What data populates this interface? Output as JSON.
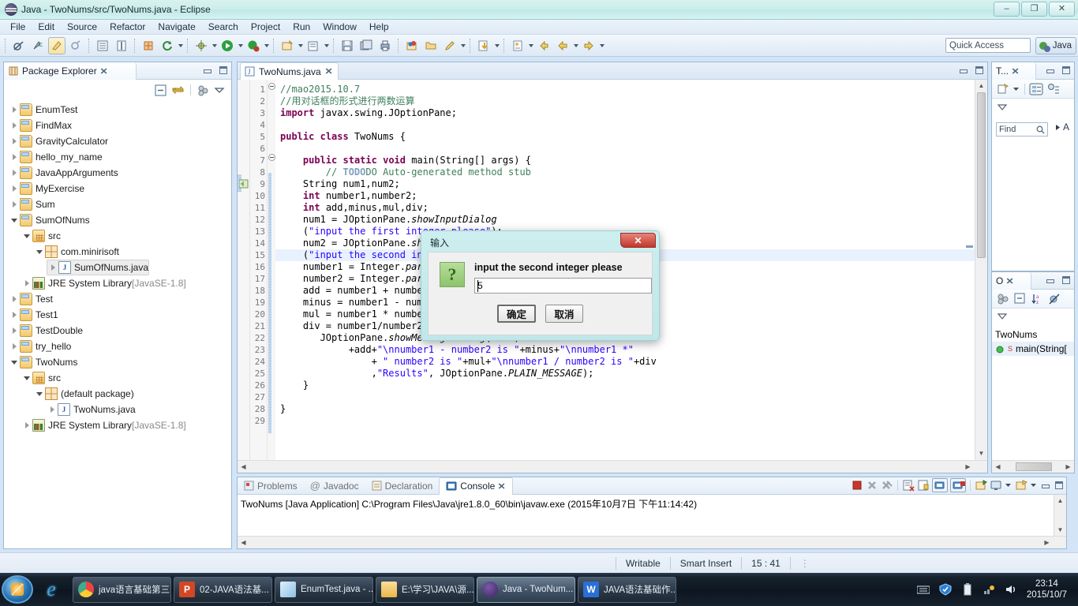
{
  "window": {
    "title": "Java - TwoNums/src/TwoNums.java - Eclipse",
    "minimize": "–",
    "restore": "❐",
    "close": "✕"
  },
  "menubar": {
    "items": [
      "File",
      "Edit",
      "Source",
      "Refactor",
      "Navigate",
      "Search",
      "Project",
      "Run",
      "Window",
      "Help"
    ]
  },
  "toolbar": {
    "quick_access_placeholder": "Quick Access",
    "perspective": "Java"
  },
  "package_explorer": {
    "tab_label": "Package Explorer",
    "close_glyph": "✕",
    "tree": [
      {
        "label": "EnumTest",
        "indent": 0,
        "arrow": "collapsed",
        "icon": "project-folder-icon",
        "selected": false
      },
      {
        "label": "FindMax",
        "indent": 0,
        "arrow": "collapsed",
        "icon": "project-folder-icon",
        "selected": false
      },
      {
        "label": "GravityCalculator",
        "indent": 0,
        "arrow": "collapsed",
        "icon": "project-folder-icon",
        "selected": false
      },
      {
        "label": "hello_my_name",
        "indent": 0,
        "arrow": "collapsed",
        "icon": "project-folder-icon",
        "selected": false
      },
      {
        "label": "JavaAppArguments",
        "indent": 0,
        "arrow": "collapsed",
        "icon": "project-folder-icon",
        "selected": false
      },
      {
        "label": "MyExercise",
        "indent": 0,
        "arrow": "collapsed",
        "icon": "project-folder-icon",
        "selected": false
      },
      {
        "label": "Sum",
        "indent": 0,
        "arrow": "collapsed",
        "icon": "project-folder-icon",
        "selected": false
      },
      {
        "label": "SumOfNums",
        "indent": 0,
        "arrow": "expanded",
        "icon": "project-folder-icon",
        "selected": false
      },
      {
        "label": "src",
        "indent": 1,
        "arrow": "expanded",
        "icon": "source-folder-icon",
        "selected": false
      },
      {
        "label": "com.minirisoft",
        "indent": 2,
        "arrow": "expanded",
        "icon": "package-icon",
        "selected": false
      },
      {
        "label": "SumOfNums.java",
        "indent": 3,
        "arrow": "collapsed",
        "icon": "java-file-icon",
        "selected": true
      },
      {
        "label": "JRE System Library",
        "suffix": "[JavaSE-1.8]",
        "indent": 1,
        "arrow": "collapsed",
        "icon": "library-icon",
        "selected": false
      },
      {
        "label": "Test",
        "indent": 0,
        "arrow": "collapsed",
        "icon": "project-folder-icon",
        "selected": false
      },
      {
        "label": "Test1",
        "indent": 0,
        "arrow": "collapsed",
        "icon": "project-folder-icon",
        "selected": false
      },
      {
        "label": "TestDouble",
        "indent": 0,
        "arrow": "collapsed",
        "icon": "project-folder-icon",
        "selected": false
      },
      {
        "label": "try_hello",
        "indent": 0,
        "arrow": "collapsed",
        "icon": "project-folder-icon",
        "selected": false
      },
      {
        "label": "TwoNums",
        "indent": 0,
        "arrow": "expanded",
        "icon": "project-folder-icon",
        "selected": false
      },
      {
        "label": "src",
        "indent": 1,
        "arrow": "expanded",
        "icon": "source-folder-icon",
        "selected": false
      },
      {
        "label": "(default package)",
        "indent": 2,
        "arrow": "expanded",
        "icon": "package-icon",
        "selected": false
      },
      {
        "label": "TwoNums.java",
        "indent": 3,
        "arrow": "collapsed",
        "icon": "java-file-icon",
        "selected": false
      },
      {
        "label": "JRE System Library",
        "suffix": "[JavaSE-1.8]",
        "indent": 1,
        "arrow": "collapsed",
        "icon": "library-icon",
        "selected": false
      }
    ]
  },
  "editor": {
    "tab_label": "TwoNums.java",
    "close_glyph": "✕",
    "first_line": 1,
    "last_line": 29,
    "highlighted_line": 15,
    "lines": [
      {
        "n": 1,
        "text": "//mao2015.10.7"
      },
      {
        "n": 2,
        "text": "//用对话框的形式进行两数运算"
      },
      {
        "n": 3,
        "text": "import javax.swing.JOptionPane;"
      },
      {
        "n": 4,
        "text": ""
      },
      {
        "n": 5,
        "text": "public class TwoNums {"
      },
      {
        "n": 6,
        "text": ""
      },
      {
        "n": 7,
        "text": "    public static void main(String[] args) {"
      },
      {
        "n": 8,
        "text": "        // TODO Auto-generated method stub"
      },
      {
        "n": 9,
        "text": "    String num1,num2;"
      },
      {
        "n": 10,
        "text": "    int number1,number2;"
      },
      {
        "n": 11,
        "text": "    int add,minus,mul,div;"
      },
      {
        "n": 12,
        "text": "    num1 = JOptionPane.showInputDialog"
      },
      {
        "n": 13,
        "text": "    (\"input the first integer please\");"
      },
      {
        "n": 14,
        "text": "    num2 = JOptionPane.showInputDialog"
      },
      {
        "n": 15,
        "text": "    (\"input the second integer please\");"
      },
      {
        "n": 16,
        "text": "    number1 = Integer.parseInt(num1);"
      },
      {
        "n": 17,
        "text": "    number2 = Integer.parseInt(num2);"
      },
      {
        "n": 18,
        "text": "    add = number1 + number2;"
      },
      {
        "n": 19,
        "text": "    minus = number1 - number2;"
      },
      {
        "n": 20,
        "text": "    mul = number1 * number2;"
      },
      {
        "n": 21,
        "text": "    div = number1/number2;"
      },
      {
        "n": 22,
        "text": "       JOptionPane.showMessageDialog(null,"
      },
      {
        "n": 23,
        "text": "            +add+\"\\nnumber1 - number2 is \"+minus+\"\\nnumber1 *\""
      },
      {
        "n": 24,
        "text": "                + \" number2 is \"+mul+\"\\nnumber1 / number2 is \"+div"
      },
      {
        "n": 25,
        "text": "                ,\"Results\", JOptionPane.PLAIN_MESSAGE);"
      },
      {
        "n": 26,
        "text": "    }"
      },
      {
        "n": 27,
        "text": ""
      },
      {
        "n": 28,
        "text": "}"
      },
      {
        "n": 29,
        "text": ""
      }
    ]
  },
  "outline_top": {
    "tab_label": "T...",
    "close_glyph": "✕",
    "find_label": "Find"
  },
  "outline_bottom": {
    "tab_label": "O",
    "close_glyph": "✕",
    "items": [
      {
        "label": "TwoNums",
        "kind": "class"
      },
      {
        "label": "main(String[",
        "kind": "method",
        "badge": "S"
      }
    ]
  },
  "console": {
    "tabs": [
      {
        "label": "Problems",
        "icon": "problems-icon",
        "active": false
      },
      {
        "label": "Javadoc",
        "icon": "javadoc-icon",
        "active": false
      },
      {
        "label": "Declaration",
        "icon": "declaration-icon",
        "active": false
      },
      {
        "label": "Console",
        "icon": "console-icon",
        "active": true
      }
    ],
    "close_glyph": "✕",
    "output": "TwoNums [Java Application] C:\\Program Files\\Java\\jre1.8.0_60\\bin\\javaw.exe (2015年10月7日 下午11:14:42)"
  },
  "statusbar": {
    "writable": "Writable",
    "insert_mode": "Smart Insert",
    "position": "15 : 41"
  },
  "dialog": {
    "title": "输入",
    "close_glyph": "✕",
    "icon_glyph": "?",
    "message": "input the second integer please",
    "input_value": "5",
    "ok_label": "确定",
    "cancel_label": "取消"
  },
  "taskbar": {
    "items": [
      {
        "label": "java语言基础第三...",
        "icon": "chrome-icon",
        "icon_char": "",
        "color": "#4caf50",
        "active": false
      },
      {
        "label": "02-JAVA语法基...",
        "icon": "powerpoint-icon",
        "icon_char": "P",
        "color": "#d24726",
        "active": false
      },
      {
        "label": "EnumTest.java - ...",
        "icon": "notepad-icon",
        "icon_char": "",
        "color": "#b9d6ea",
        "active": false
      },
      {
        "label": "E:\\学习\\JAVA\\源...",
        "icon": "folder-icon",
        "icon_char": "",
        "color": "#f2c75c",
        "active": false
      },
      {
        "label": "Java - TwoNum...",
        "icon": "eclipse-icon",
        "icon_char": "",
        "color": "#4b2f6e",
        "active": true
      },
      {
        "label": "JAVA语法基础作...",
        "icon": "wps-icon",
        "icon_char": "W",
        "color": "#2a6fd6",
        "active": false
      }
    ],
    "clock_time": "23:14",
    "clock_date": "2015/10/7"
  }
}
